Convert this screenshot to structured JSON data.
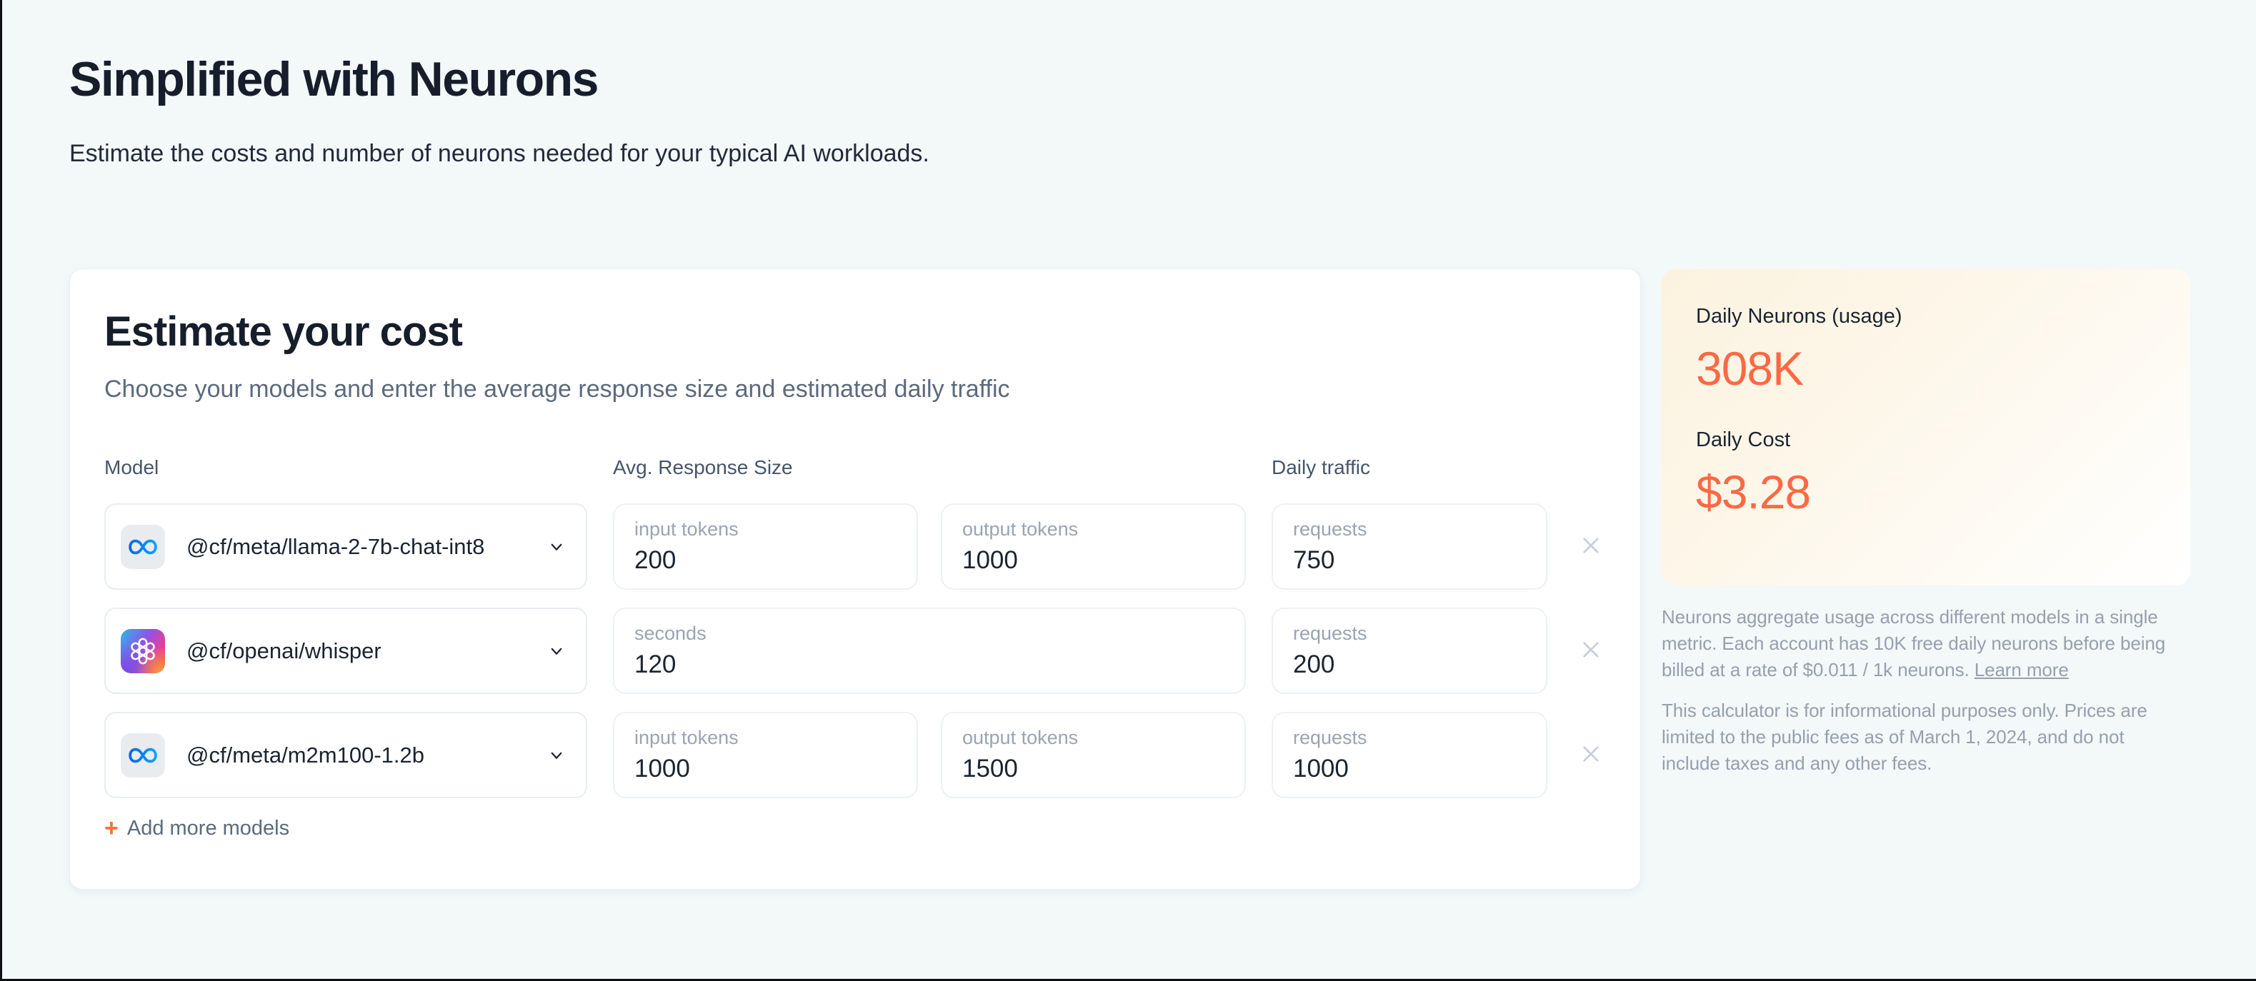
{
  "page": {
    "title": "Simplified with Neurons",
    "subtitle": "Estimate the costs and number of neurons needed for your typical AI workloads."
  },
  "calculator": {
    "title": "Estimate your cost",
    "subtitle": "Choose your models and enter the average response size and estimated daily traffic",
    "columns": {
      "model": "Model",
      "response": "Avg. Response Size",
      "traffic": "Daily traffic"
    },
    "rows": [
      {
        "provider_icon": "meta-icon",
        "model": "@cf/meta/llama-2-7b-chat-int8",
        "inputs": [
          {
            "label": "input tokens",
            "value": "200"
          },
          {
            "label": "output tokens",
            "value": "1000"
          }
        ],
        "traffic": {
          "label": "requests",
          "value": "750"
        }
      },
      {
        "provider_icon": "openai-icon",
        "model": "@cf/openai/whisper",
        "inputs": [
          {
            "label": "seconds",
            "value": "120"
          }
        ],
        "traffic": {
          "label": "requests",
          "value": "200"
        }
      },
      {
        "provider_icon": "meta-icon",
        "model": "@cf/meta/m2m100-1.2b",
        "inputs": [
          {
            "label": "input tokens",
            "value": "1000"
          },
          {
            "label": "output tokens",
            "value": "1500"
          }
        ],
        "traffic": {
          "label": "requests",
          "value": "1000"
        }
      }
    ],
    "add_more": {
      "plus": "+",
      "label": "Add more models"
    }
  },
  "summary": {
    "neurons_label": "Daily Neurons (usage)",
    "neurons_value": "308K",
    "cost_label": "Daily Cost",
    "cost_value": "$3.28",
    "note1": "Neurons aggregate usage across different models in a single metric. Each account has 10K free daily neurons before being billed at a rate of $0.011 / 1k neurons. ",
    "learn_more": "Learn more",
    "note2": "This calculator is for informational purposes only. Prices are limited to the public fees as of March 1, 2024, and do not include taxes and any other fees."
  },
  "colors": {
    "accent_orange": "#FB6944",
    "plus_orange": "#F4743B",
    "page_background": "#F3F8F9",
    "summary_cream": "#FCF2DF",
    "meta_blue": "#0667E0",
    "text_dark": "#161D2B",
    "text_gray": "#5B6A7D",
    "label_gray": "#9AA4B2",
    "note_gray": "#96A0AD"
  }
}
